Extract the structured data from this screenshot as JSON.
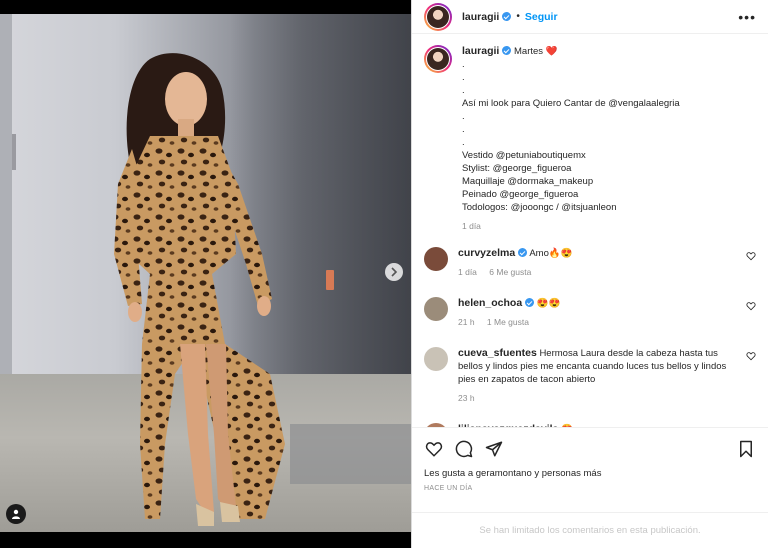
{
  "post": {
    "author": "lauragii",
    "follow_label": "Seguir",
    "dot": "•",
    "more": "•••"
  },
  "caption": {
    "lines": [
      "Martes ❤️",
      ".",
      ".",
      ".",
      "Así mi look para Quiero Cantar de @vengalaalegria",
      ".",
      ".",
      ".",
      "Vestido @petuniaboutiquemx",
      "Stylist: @george_figueroa",
      "Maquillaje @dormaka_makeup",
      "Peinado @george_figueroa",
      "Todologos: @jooongc / @itsjuanleon"
    ],
    "time": "1 día"
  },
  "comments": [
    {
      "user": "curvyzelma",
      "verified": true,
      "text": "Amo🔥😍",
      "time": "1 día",
      "likes": "6 Me gusta"
    },
    {
      "user": "helen_ochoa",
      "verified": true,
      "text": "😍😍",
      "time": "21 h",
      "likes": "1 Me gusta"
    },
    {
      "user": "cueva_sfuentes",
      "verified": false,
      "text": "Hermosa Laura desde la cabeza hasta tus bellos y lindos pies me encanta cuando luces tus bellos y lindos pies en zapatos de tacon abierto",
      "time": "23 h",
      "likes": ""
    },
    {
      "user": "lilianavazquezdavila",
      "verified": false,
      "text": "😍",
      "time": "",
      "likes": ""
    }
  ],
  "likes_text": "Les gusta a geramontano y personas más",
  "posted_time": "HACE UN DÍA",
  "comments_limited": "Se han limitado los comentarios en esta publicación.",
  "colors": {
    "accent": "#0095f6",
    "verified": "#3897f0",
    "muted": "#8e8e8e"
  }
}
